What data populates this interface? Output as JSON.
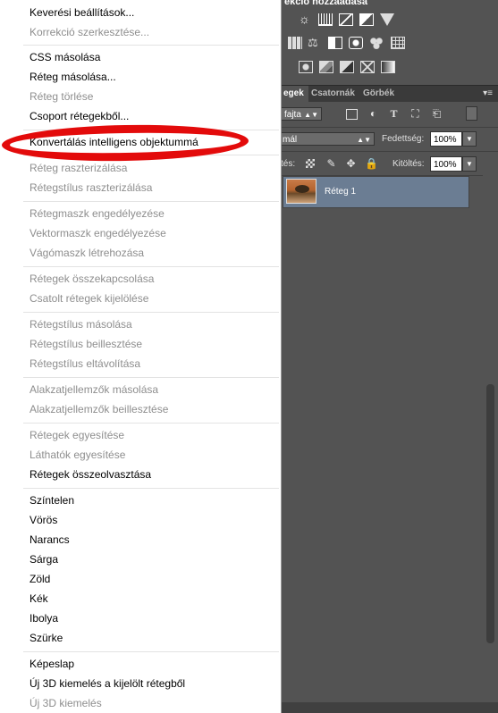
{
  "panel": {
    "adjustments_title": "ekció hozzáadása",
    "tabs": [
      {
        "label": "Rétegek",
        "visible_label": "egek"
      },
      {
        "label": "Csatornák"
      },
      {
        "label": "Görbék"
      }
    ],
    "kind_filter": "fajta",
    "blend_mode": "mál",
    "opacity_label": "Fedettség:",
    "opacity_value": "100%",
    "lock_label": "tés:",
    "fill_label": "Kitöltés:",
    "fill_value": "100%",
    "layer_name": "Réteg 1"
  },
  "menu": {
    "items": [
      {
        "label": "Keverési beállítások...",
        "enabled": true
      },
      {
        "label": "Korrekció szerkesztése...",
        "enabled": false
      },
      {
        "label": "CSS másolása",
        "enabled": true
      },
      {
        "label": "Réteg másolása...",
        "enabled": true
      },
      {
        "label": "Réteg törlése",
        "enabled": false
      },
      {
        "label": "Csoport rétegekből...",
        "enabled": true
      },
      {
        "label": "Konvertálás intelligens objektummá",
        "enabled": true
      },
      {
        "label": "Réteg raszterizálása",
        "enabled": false
      },
      {
        "label": "Rétegstílus raszterizálása",
        "enabled": false
      },
      {
        "label": "Rétegmaszk engedélyezése",
        "enabled": false
      },
      {
        "label": "Vektormaszk engedélyezése",
        "enabled": false
      },
      {
        "label": "Vágómaszk létrehozása",
        "enabled": false
      },
      {
        "label": "Rétegek összekapcsolása",
        "enabled": false
      },
      {
        "label": "Csatolt rétegek kijelölése",
        "enabled": false
      },
      {
        "label": "Rétegstílus másolása",
        "enabled": false
      },
      {
        "label": "Rétegstílus beillesztése",
        "enabled": false
      },
      {
        "label": "Rétegstílus eltávolítása",
        "enabled": false
      },
      {
        "label": "Alakzatjellemzők másolása",
        "enabled": false
      },
      {
        "label": "Alakzatjellemzők beillesztése",
        "enabled": false
      },
      {
        "label": "Rétegek egyesítése",
        "enabled": false
      },
      {
        "label": "Láthatók egyesítése",
        "enabled": false
      },
      {
        "label": "Rétegek összeolvasztása",
        "enabled": true
      },
      {
        "label": "Színtelen",
        "enabled": true
      },
      {
        "label": "Vörös",
        "enabled": true
      },
      {
        "label": "Narancs",
        "enabled": true
      },
      {
        "label": "Sárga",
        "enabled": true
      },
      {
        "label": "Zöld",
        "enabled": true
      },
      {
        "label": "Kék",
        "enabled": true
      },
      {
        "label": "Ibolya",
        "enabled": true
      },
      {
        "label": "Szürke",
        "enabled": true
      },
      {
        "label": "Képeslap",
        "enabled": true
      },
      {
        "label": "Új 3D kiemelés a kijelölt rétegből",
        "enabled": true
      },
      {
        "label": "Új 3D kiemelés",
        "enabled": false
      }
    ]
  },
  "annotation_color": "#e30b0b"
}
